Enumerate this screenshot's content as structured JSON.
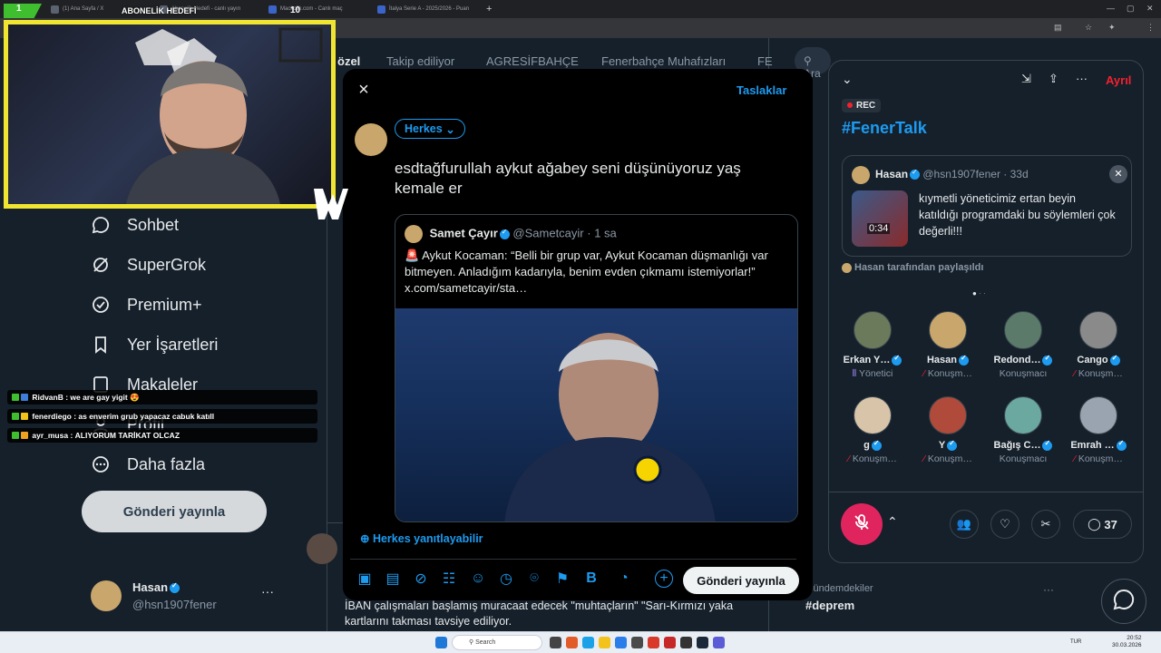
{
  "browser": {
    "tabs": [
      {
        "label": "(1) Ana Sayfa / X",
        "color": "#5b6270"
      },
      {
        "label": "Abonelik Hedefi - canlı yayın",
        "color": "#5b6270"
      },
      {
        "label": "Mackolik.com - Canlı maç",
        "color": "#3b64c8"
      },
      {
        "label": "İtalya Serie A - 2025/2026 - Puan",
        "color": "#3b64c8"
      }
    ],
    "new_tab": "+"
  },
  "stream": {
    "cam_number": "1",
    "sub_goal": "ABONELİK HEDEFİ",
    "cam_right_number": "10",
    "chat": [
      {
        "user": "RidvanB",
        "message": "we are gay yigit 😍"
      },
      {
        "user": "fenerdiego",
        "message": "as enverim grub yapacaz cabuk katıll"
      },
      {
        "user": "ayr_musa",
        "message": "ALIYORUM TARİKAT OLCAZ"
      }
    ]
  },
  "leftnav": {
    "items": [
      {
        "label": "Sohbet",
        "icon": "chat-bubble-icon"
      },
      {
        "label": "SuperGrok",
        "icon": "grok-icon"
      },
      {
        "label": "Premium+",
        "icon": "verified-badge-icon"
      },
      {
        "label": "Yer İşaretleri",
        "icon": "bookmark-icon"
      },
      {
        "label": "Makaleler",
        "icon": "article-icon"
      },
      {
        "label": "Profil",
        "icon": "profile-icon"
      },
      {
        "label": "Daha fazla",
        "icon": "more-circle-icon"
      }
    ],
    "post_button": "Gönderi yayınla",
    "profile_name": "Hasan",
    "profile_handle": "@hsn1907fener",
    "profile_more": "···"
  },
  "feed": {
    "tabs": [
      "özel",
      "Takip ediliyor",
      "AGRESİFBAHÇE",
      "Fenerbahçe Muhafızları",
      "FE"
    ],
    "bottom_text": "İBAN çalışmaları başlamış muracaat edecek \"muhtaçların\" \"Sarı-Kırmızı yaka kartlarını takması tavsiye ediliyor."
  },
  "compose": {
    "close": "×",
    "drafts": "Taslaklar",
    "audience": "Herkes",
    "text": "esdtağfurullah aykut ağabey seni düşünüyoruz yaş kemale er",
    "quote": {
      "name": "Samet Çayır",
      "handle": "@Sametcayir",
      "time": "· 1 sa",
      "text": "🚨 Aykut Kocaman: “Belli bir grup var, Aykut Kocaman düşmanlığı var bitmeyen. Anladığım kadarıyla, benim evden çıkmamı istemiyorlar!” x.com/sametcayir/sta…"
    },
    "reply_setting": "Herkes yanıtlayabilir",
    "submit": "Gönderi yayınla"
  },
  "space": {
    "leave": "Ayrıl",
    "rec": "REC",
    "title": "#FenerTalk",
    "pinned": {
      "name": "Hasan",
      "handle": "@hsn1907fener",
      "time": "· 33d",
      "video_time": "0:34",
      "text": "kıymetli yöneticimiz ertan beyin katıldığı programdaki bu söylemleri çok değerli!!!",
      "shared_by": "Hasan tarafından paylaşıldı"
    },
    "speakers": [
      {
        "name": "Erkan Y…",
        "role": "Yönetici",
        "color": "#6a7a5a"
      },
      {
        "name": "Hasan",
        "role": "Konuşm…",
        "color": "#c9a66b"
      },
      {
        "name": "Redond…",
        "role": "Konuşmacı",
        "color": "#5b7a6a"
      },
      {
        "name": "Cango",
        "role": "Konuşm…",
        "color": "#8a8a8a"
      },
      {
        "name": "g",
        "role": "Konuşm…",
        "color": "#d8c4a8"
      },
      {
        "name": "Y",
        "role": "Konuşm…",
        "color": "#b04a3a"
      },
      {
        "name": "Bağış C…",
        "role": "Konuşmacı",
        "color": "#6aa8a0"
      },
      {
        "name": "Emrah …",
        "role": "Konuşm…",
        "color": "#9aa4b0"
      }
    ],
    "reply_count": "37"
  },
  "right": {
    "trend_label": "Gündemdekiler",
    "trend_tag": "#deprem",
    "search_placeholder": "Ara"
  },
  "taskbar": {
    "search": "Search",
    "lang": "TUR",
    "time": "20:52",
    "date": "30.03.2026"
  }
}
